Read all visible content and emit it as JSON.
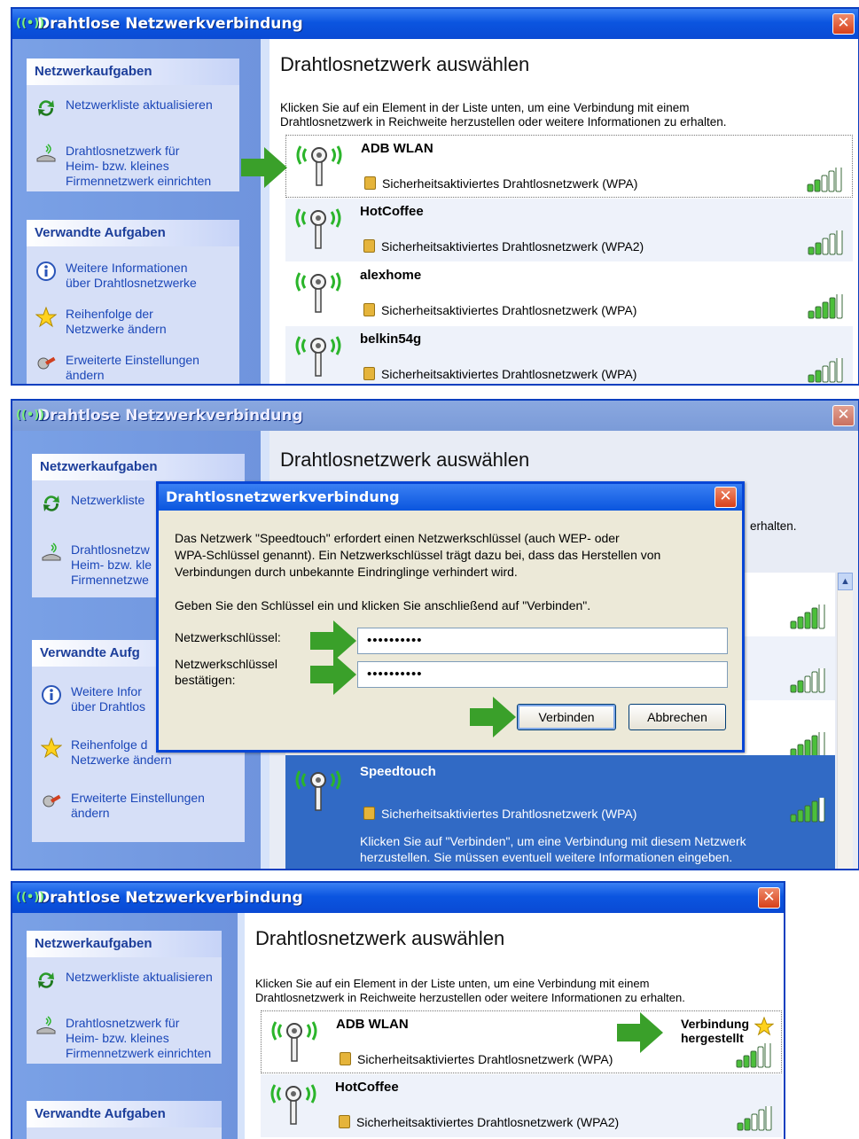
{
  "windows": [
    {
      "title": "Drahtlose Netzwerkverbindung",
      "tasks_header": "Netzwerkaufgaben",
      "refresh": "Netzwerkliste aktualisieren",
      "setup_line1": "Drahtlosnetzwerk für",
      "setup_line2": "Heim- bzw. kleines",
      "setup_line3": "Firmennetzwerk einrichten",
      "related_header": "Verwandte Aufgaben",
      "info_line1": "Weitere Informationen",
      "info_line2": "über Drahtlosnetzwerke",
      "order_line1": "Reihenfolge der",
      "order_line2": "Netzwerke ändern",
      "adv_line1": "Erweiterte Einstellungen",
      "adv_line2": "ändern",
      "heading": "Drahtlosnetzwerk auswählen",
      "instr_line1": "Klicken Sie auf ein Element in der Liste unten, um eine Verbindung mit einem",
      "instr_line2": "Drahtlosnetzwerk in Reichweite herzustellen oder weitere Informationen zu erhalten.",
      "networks": [
        {
          "ssid": "ADB WLAN",
          "security": "Sicherheitsaktiviertes Drahtlosnetzwerk (WPA)",
          "signal": 2
        },
        {
          "ssid": "HotCoffee",
          "security": "Sicherheitsaktiviertes Drahtlosnetzwerk (WPA2)",
          "signal": 2
        },
        {
          "ssid": "alexhome",
          "security": "Sicherheitsaktiviertes Drahtlosnetzwerk (WPA)",
          "signal": 4
        },
        {
          "ssid": "belkin54g",
          "security": "Sicherheitsaktiviertes Drahtlosnetzwerk (WPA)",
          "signal": 2
        }
      ]
    },
    {
      "title": "Drahtlose Netzwerkverbindung",
      "tasks_header": "Netzwerkaufgaben",
      "refresh": "Netzwerkliste",
      "setup_line1": "Drahtlosnetzw",
      "setup_line2": "Heim- bzw. kle",
      "setup_line3": "Firmennetzwe",
      "related_header": "Verwandte Aufg",
      "info_line1": "Weitere Infor",
      "info_line2": "über Drahtlos",
      "order_line1": "Reihenfolge d",
      "order_line2": "Netzwerke ändern",
      "adv_line1": "Erweiterte Einstellungen",
      "adv_line2": "ändern",
      "heading": "Drahtlosnetzwerk auswählen",
      "instr_tail": "erhalten.",
      "selected": {
        "ssid": "Speedtouch",
        "security": "Sicherheitsaktiviertes Drahtlosnetzwerk (WPA)",
        "hint_line1": "Klicken Sie auf \"Verbinden\", um eine Verbindung mit diesem Netzwerk",
        "hint_line2": "herzustellen. Sie müssen eventuell weitere Informationen eingeben."
      },
      "dialog": {
        "title": "Drahtlosnetzwerkverbindung",
        "body_line1": "Das Netzwerk \"Speedtouch\" erfordert einen Netzwerkschlüssel (auch WEP- oder",
        "body_line2": "WPA-Schlüssel genannt). Ein Netzwerkschlüssel trägt dazu bei, dass das Herstellen von",
        "body_line3": "Verbindungen durch unbekannte Eindringlinge verhindert wird.",
        "prompt": "Geben Sie den Schlüssel ein und klicken Sie anschließend auf \"Verbinden\".",
        "key_label": "Netzwerkschlüssel:",
        "confirm_label_line1": "Netzwerkschlüssel",
        "confirm_label_line2": "bestätigen:",
        "key_value": "••••••••••",
        "confirm_value": "••••••••••",
        "connect": "Verbinden",
        "cancel": "Abbrechen"
      }
    },
    {
      "title": "Drahtlose Netzwerkverbindung",
      "tasks_header": "Netzwerkaufgaben",
      "refresh": "Netzwerkliste aktualisieren",
      "setup_line1": "Drahtlosnetzwerk für",
      "setup_line2": "Heim- bzw. kleines",
      "setup_line3": "Firmennetzwerk einrichten",
      "related_header": "Verwandte Aufgaben",
      "heading": "Drahtlosnetzwerk auswählen",
      "instr_line1": "Klicken Sie auf ein Element in der Liste unten, um eine Verbindung mit einem",
      "instr_line2": "Drahtlosnetzwerk in Reichweite herzustellen oder weitere Informationen zu erhalten.",
      "status_line1": "Verbindung",
      "status_line2": "hergestellt",
      "networks": [
        {
          "ssid": "ADB WLAN",
          "security": "Sicherheitsaktiviertes Drahtlosnetzwerk (WPA)",
          "signal": 3
        },
        {
          "ssid": "HotCoffee",
          "security": "Sicherheitsaktiviertes Drahtlosnetzwerk (WPA2)",
          "signal": 2
        }
      ]
    }
  ],
  "icons": {
    "arrow": "green-arrow-icon",
    "antenna": "wireless-antenna-icon",
    "signal": "signal-strength-icon",
    "lock": "lock-icon"
  },
  "colors": {
    "title_bar": "#0b55e0",
    "task_pane": "#7aa1e6",
    "selected_row": "#316ac5",
    "arrow": "#3aa02a"
  }
}
